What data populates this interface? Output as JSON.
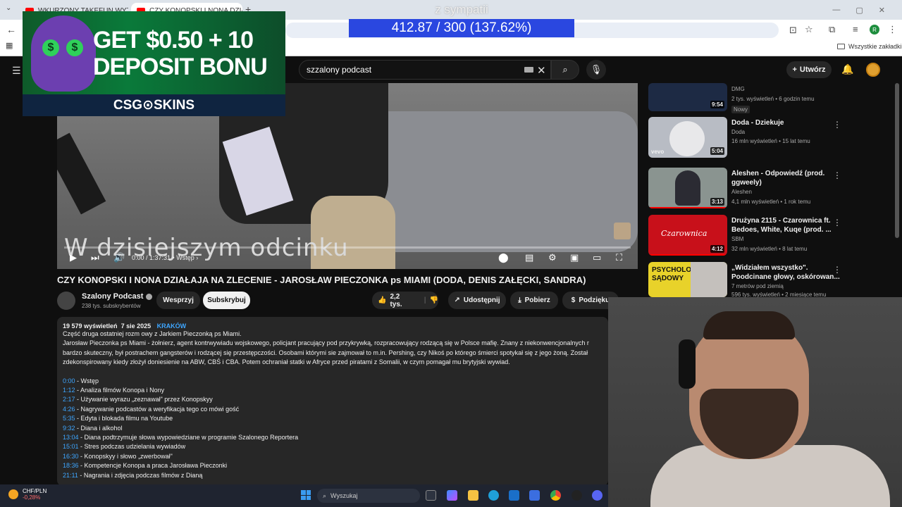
{
  "browser": {
    "tabs": [
      {
        "title": "WKURZONY TAKEFUN WYTYK"
      },
      {
        "title": "CZY KONOPSKI I NONA DZIAŁA"
      }
    ],
    "bookmarks_label": "Wszystkie zakładki",
    "profile_initial": "R"
  },
  "overlay": {
    "stream_title": "z sympatii",
    "goal_text": "412.87 / 300 (137.62%)",
    "ad_line1": "GET $0.50 + 10",
    "ad_line2": "DEPOSIT BONU",
    "ad_brand": "CSG⊙SKINS",
    "ad_eye": "$"
  },
  "youtube": {
    "search_value": "szzalony podcast",
    "create_label": "Utwórz",
    "video": {
      "subtitle": "W dzisiejszym odcinku",
      "time": "0:00 / 1:37:31",
      "chapter": "Wstęp",
      "title": "CZY KONOPSKI I NONA DZIAŁAJA NA ZLECENIE - JAROSŁAW PIECZONKA ps MIAMI (DODA, DENIS ZAŁĘCKI, SANDRA)"
    },
    "channel": {
      "name": "Szalony Podcast",
      "subs": "238 tys. subskrybentów",
      "support_label": "Wesprzyj",
      "subscribe_label": "Subskrybuj"
    },
    "actions": {
      "likes": "2,2 tys.",
      "share": "Udostępnij",
      "download": "Pobierz",
      "thanks": "Podzięku"
    },
    "description": {
      "views": "19 579 wyświetleń",
      "date": "7 sie 2025",
      "hashtag": "KRAKÓW",
      "lines": [
        "Część druga ostatniej rozm owy z Jarkiem Pieczonką ps Miami.",
        "Jarosław Pieczonka ps Miami - żołnierz, agent kontrwywiadu wojskowego, policjant pracujący pod przykrywką, rozpracowujący rodzącą się w Polsce mafię. Znany z niekonwencjonalnych r",
        "bardzo skuteczny, był postrachem gangsterów i rodzącej się przestępczości. Osobami którymi sie zajmował to m.in. Pershing, czy Nikoś po którego śmierci spotykał się z jego żoną. Został",
        "zdekonspirowany kiedy złożył doniesienie na ABW, CBŚ i CBA. Potem ochraniał statki w Afryce przed piratami z Somalii, w czym pomagał mu brytyjski wywiad."
      ],
      "chapters": [
        {
          "ts": "0:00",
          "label": " - Wstęp"
        },
        {
          "ts": "1:12",
          "label": " - Analiza filmów Konopa i Nony"
        },
        {
          "ts": "2:17",
          "label": " - Używanie wyrazu „zeznawał\" przez Konopskyy"
        },
        {
          "ts": "4:26",
          "label": " - Nagrywanie podcastów a weryfikacja tego co mówi gość"
        },
        {
          "ts": "5:35",
          "label": " - Edyta i blokada filmu na Youtube"
        },
        {
          "ts": "9:32",
          "label": " - Diana i alkohol"
        },
        {
          "ts": "13:04",
          "label": " - Diana podtrzymuje słowa wypowiedziane w programie Szalonego Reportera"
        },
        {
          "ts": "15:01",
          "label": " - Stres podczas udzielania wywiadów"
        },
        {
          "ts": "16:30",
          "label": " - Konopskyy i słowo „zwerbował\""
        },
        {
          "ts": "18:36",
          "label": " - Kompetencje Konopa a praca Jarosława Pieczonki"
        },
        {
          "ts": "21:11",
          "label": " - Nagrania i zdjęcia podczas filmów z Dianą"
        }
      ]
    },
    "sidebar": [
      {
        "title": "",
        "channel": "DMG",
        "meta": "2 tys. wyświetleń • 6 godzin temu",
        "badge": "Nowy",
        "duration": "9:54",
        "color": "#1d2a44"
      },
      {
        "title": "Doda - Dziekuje",
        "channel": "Doda",
        "meta": "16 mln wyświetleń • 15 lat temu",
        "duration": "5:04",
        "color": "#b8bcc4",
        "brand": "vevo"
      },
      {
        "title": "Aleshen - Odpowiedź (prod.",
        "title2": "ggweely)",
        "channel": "Aleshen",
        "meta": "4,1 mln wyświetleń • 1 rok temu",
        "duration": "3:13",
        "color": "#8a9490"
      },
      {
        "title": "Drużyna 2115 - Czarownica ft.",
        "title2": "Bedoes, White, Kuqe (prod. ...",
        "channel": "SBM",
        "meta": "32 mln wyświetleń • 8 lat temu",
        "duration": "4:12",
        "color": "#c8101a",
        "thumb_text": "Czarownica"
      },
      {
        "title": "„Widziałem wszystko\".",
        "title2": "Poodcinane głowy, oskórowan...",
        "channel": "7 metrów pod ziemią",
        "meta": "596 tys. wyświetleń • 2 miesiące temu",
        "color": "#e8d22a",
        "thumb_text": "PSYCHOLOG SĄDOWY"
      }
    ]
  },
  "taskbar": {
    "weather_title": "CHF/PLN",
    "weather_value": "-0,28%",
    "search_placeholder": "Wyszukaj"
  }
}
